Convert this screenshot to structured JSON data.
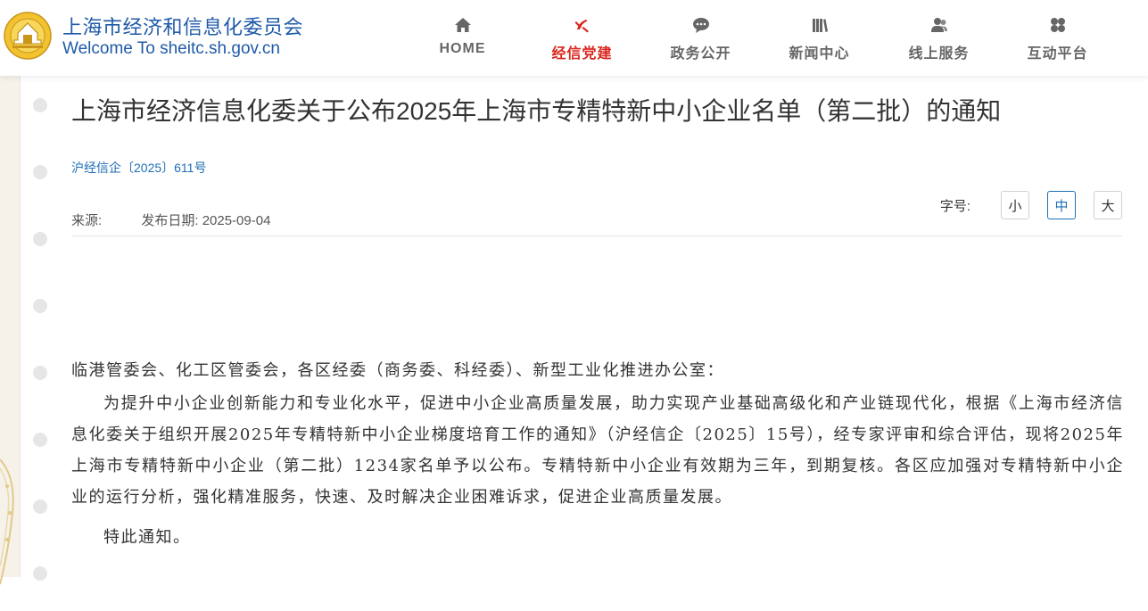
{
  "site": {
    "name_cn": "上海市经济和信息化委员会",
    "name_en": "Welcome To sheitc.sh.gov.cn"
  },
  "colors": {
    "brand_blue": "#1f5aa8",
    "active_red": "#d9251c",
    "link_blue": "#1f6fb5"
  },
  "nav": [
    {
      "label": "HOME",
      "icon": "home-icon",
      "active": false
    },
    {
      "label": "经信党建",
      "icon": "party-emblem-icon",
      "active": true
    },
    {
      "label": "政务公开",
      "icon": "speech-bubble-icon",
      "active": false
    },
    {
      "label": "新闻中心",
      "icon": "books-icon",
      "active": false
    },
    {
      "label": "线上服务",
      "icon": "users-icon",
      "active": false
    },
    {
      "label": "互动平台",
      "icon": "clover-icon",
      "active": false
    }
  ],
  "article": {
    "title": "上海市经济信息化委关于公布2025年上海市专精特新中小企业名单（第二批）的通知",
    "doc_number": "沪经信企〔2025〕611号",
    "source_label": "来源:",
    "source_value": "",
    "date_label": "发布日期:",
    "date_value": "2025-09-04",
    "font_size_label": "字号:",
    "font_sizes": [
      "小",
      "中",
      "大"
    ],
    "font_size_selected": "中",
    "addressee": "临港管委会、化工区管委会，各区经委（商务委、科经委）、新型工业化推进办公室：",
    "body": "为提升中小企业创新能力和专业化水平，促进中小企业高质量发展，助力实现产业基础高级化和产业链现代化，根据《上海市经济信息化委关于组织开展2025年专精特新中小企业梯度培育工作的通知》（沪经信企〔2025〕15号），经专家评审和综合评估，现将2025年上海市专精特新中小企业（第二批）1234家名单予以公布。专精特新中小企业有效期为三年，到期复核。各区应加强对专精特新中小企业的运行分析，强化精准服务，快速、及时解决企业困难诉求，促进企业高质量发展。",
    "closing": "特此通知。"
  }
}
